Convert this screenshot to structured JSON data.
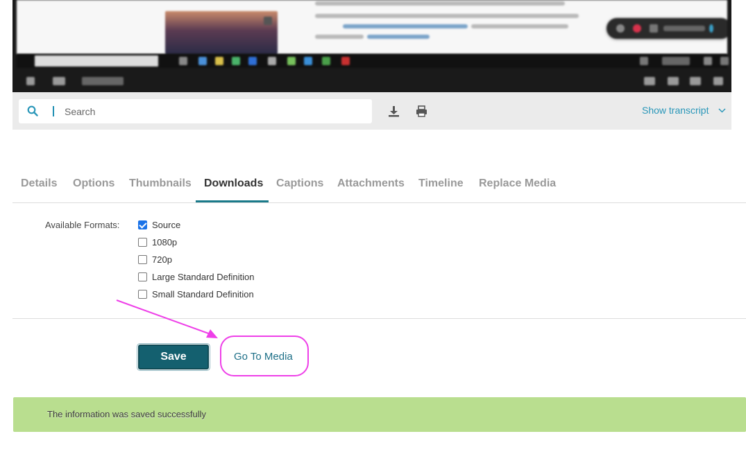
{
  "player": {
    "search_placeholder": "Search",
    "show_transcript_label": "Show transcript"
  },
  "tabs": [
    {
      "label": "Details",
      "active": false
    },
    {
      "label": "Options",
      "active": false
    },
    {
      "label": "Thumbnails",
      "active": false
    },
    {
      "label": "Downloads",
      "active": true
    },
    {
      "label": "Captions",
      "active": false
    },
    {
      "label": "Attachments",
      "active": false
    },
    {
      "label": "Timeline",
      "active": false
    },
    {
      "label": "Replace Media",
      "active": false
    }
  ],
  "downloads": {
    "label": "Available Formats:",
    "formats": [
      {
        "label": "Source",
        "checked": true
      },
      {
        "label": "1080p",
        "checked": false
      },
      {
        "label": "720p",
        "checked": false
      },
      {
        "label": "Large Standard Definition",
        "checked": false
      },
      {
        "label": "Small Standard Definition",
        "checked": false
      }
    ]
  },
  "actions": {
    "save_label": "Save",
    "go_to_media_label": "Go To Media"
  },
  "alert": {
    "message": "The information was saved successfully"
  },
  "colors": {
    "accent": "#2a97b9",
    "save_button": "#14606f",
    "success_bg": "#b9de8f",
    "annotation": "#ee3fe8"
  }
}
